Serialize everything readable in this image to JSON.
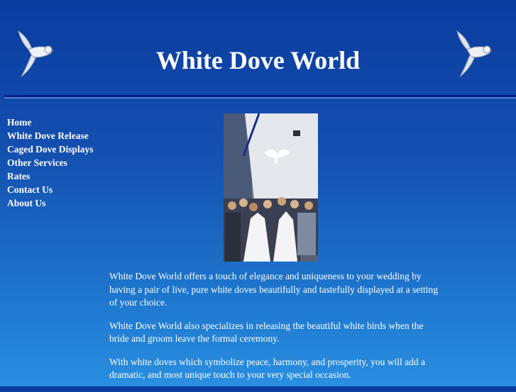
{
  "header": {
    "title": "White Dove World"
  },
  "nav": {
    "items": [
      {
        "label": "Home"
      },
      {
        "label": "White Dove Release"
      },
      {
        "label": "Caged Dove Displays"
      },
      {
        "label": "Other Services"
      },
      {
        "label": "Rates"
      },
      {
        "label": "Contact Us"
      },
      {
        "label": "About Us"
      }
    ]
  },
  "content": {
    "paragraphs": [
      "White Dove World offers a touch of elegance and uniqueness to your wedding by having a pair of live, pure white doves beautifully and tastefully displayed at a setting of your choice.",
      "White Dove World also specializes in releasing the beautiful white birds when the bride and groom leave the formal ceremony.",
      "With white doves which symbolize peace, harmony, and prosperity, you will add a dramatic, and most unique touch to your very special occasion."
    ]
  },
  "colors": {
    "background_top": "#0a3c9e",
    "background_bottom": "#2a8ee0",
    "rule": "#00208a",
    "text": "#ffffff"
  },
  "icons": {
    "left_dove": "dove-icon",
    "right_dove": "dove-icon"
  }
}
